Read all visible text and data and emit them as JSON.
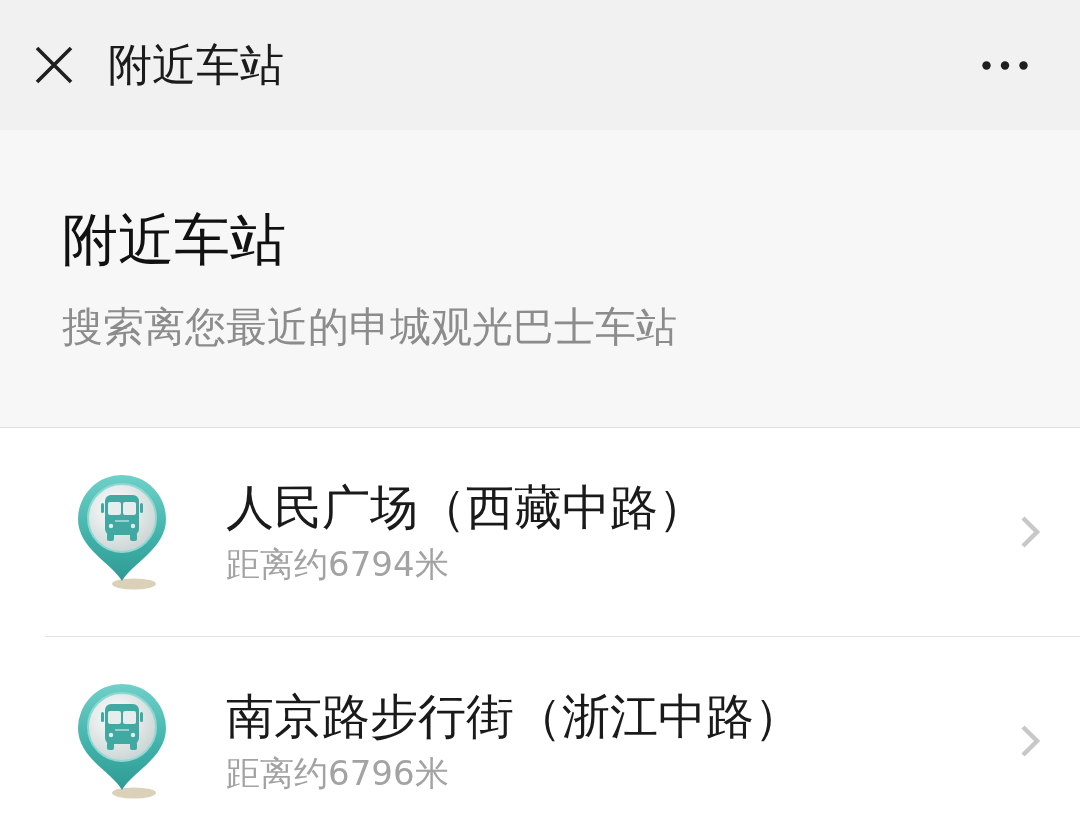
{
  "header": {
    "title": "附近车站"
  },
  "intro": {
    "title": "附近车站",
    "subtitle": "搜索离您最近的申城观光巴士车站"
  },
  "stations": [
    {
      "name": "人民广场（西藏中路）",
      "distance": "距离约6794米"
    },
    {
      "name": "南京路步行街（浙江中路）",
      "distance": "距离约6796米"
    }
  ]
}
